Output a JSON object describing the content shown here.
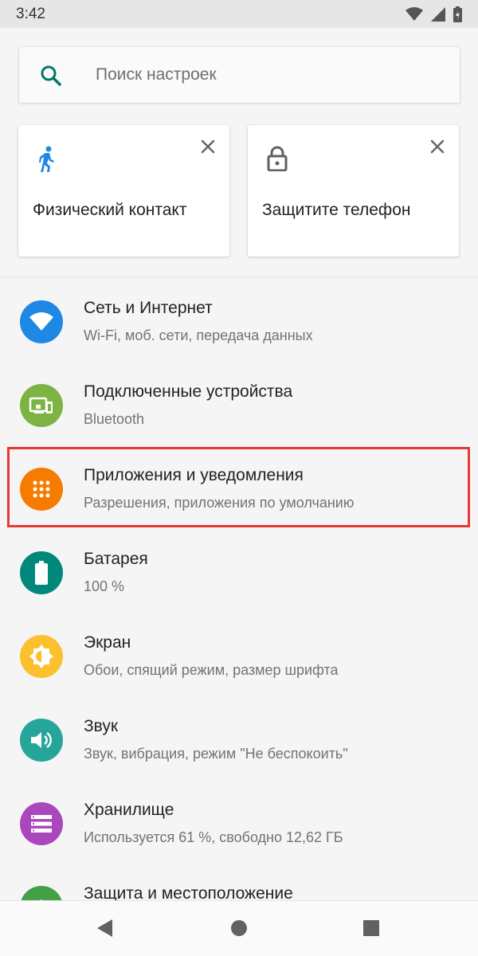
{
  "status_bar": {
    "time": "3:42"
  },
  "search": {
    "placeholder": "Поиск настроек"
  },
  "suggestions": [
    {
      "title": "Физический контакт",
      "icon": "walking-person-icon"
    },
    {
      "title": "Защитите телефон",
      "icon": "lock-icon"
    }
  ],
  "settings": [
    {
      "title": "Сеть и Интернет",
      "subtitle": "Wi-Fi, моб. сети, передача данных",
      "icon": "wifi-icon",
      "color": "#1e88e5"
    },
    {
      "title": "Подключенные устройства",
      "subtitle": "Bluetooth",
      "icon": "devices-icon",
      "color": "#7cb342"
    },
    {
      "title": "Приложения и уведомления",
      "subtitle": "Разрешения, приложения по умолчанию",
      "icon": "apps-grid-icon",
      "color": "#f57c00"
    },
    {
      "title": "Батарея",
      "subtitle": "100 %",
      "icon": "battery-icon",
      "color": "#00897b"
    },
    {
      "title": "Экран",
      "subtitle": "Обои, спящий режим, размер шрифта",
      "icon": "brightness-icon",
      "color": "#fbc02d"
    },
    {
      "title": "Звук",
      "subtitle": "Звук, вибрация, режим \"Не беспокоить\"",
      "icon": "volume-icon",
      "color": "#26a69a"
    },
    {
      "title": "Хранилище",
      "subtitle": "Используется 61 %, свободно 12,62 ГБ",
      "icon": "storage-icon",
      "color": "#ab47bc"
    },
    {
      "title": "Защита и местоположение",
      "subtitle": "",
      "icon": "security-location-icon",
      "color": "#43a047"
    }
  ],
  "highlight_color": "#e53935"
}
